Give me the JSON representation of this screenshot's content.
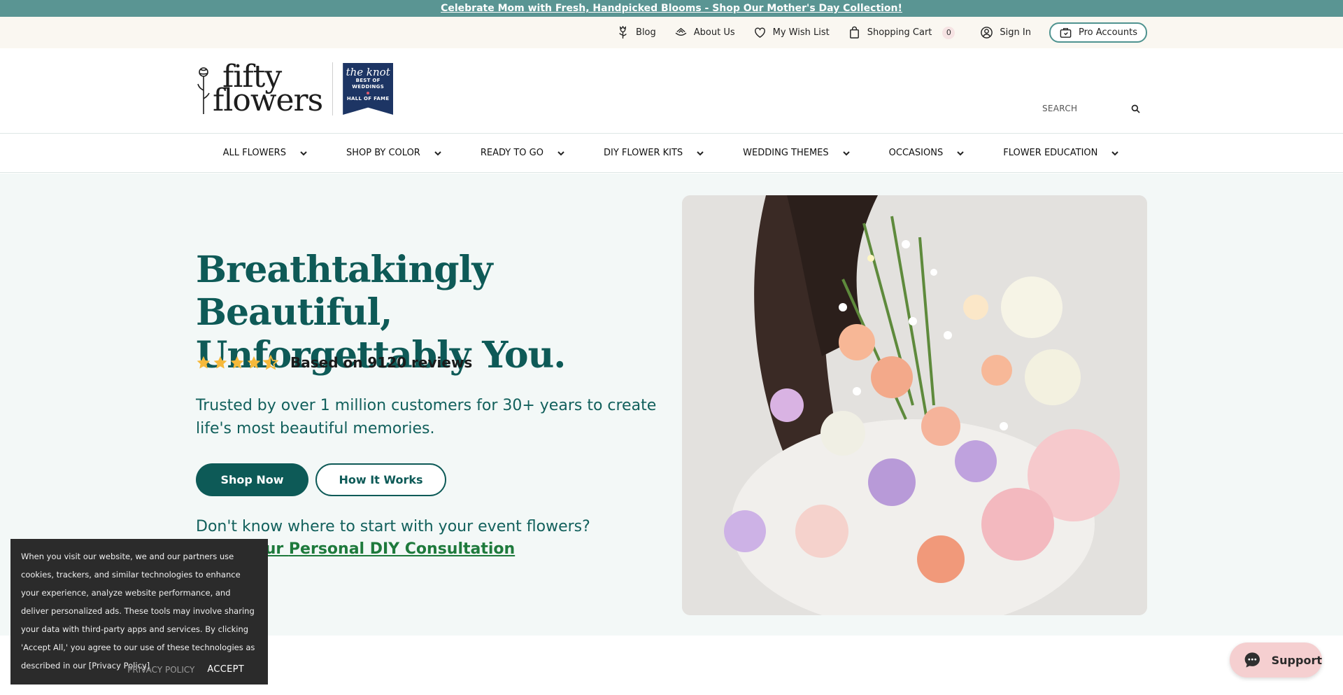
{
  "announcement": {
    "text": "Celebrate Mom with Fresh, Handpicked Blooms - Shop Our Mother's Day Collection!"
  },
  "utility_nav": {
    "blog": "Blog",
    "about": "About Us",
    "wishlist": "My Wish List",
    "cart": "Shopping Cart",
    "cart_count": "0",
    "signin": "Sign In",
    "pro": "Pro Accounts"
  },
  "logo": {
    "line1": "fifty",
    "line2": "flowers"
  },
  "badge": {
    "title": "the knot",
    "line1": "BEST OF",
    "line2": "WEDDINGS",
    "line3": "HALL OF FAME"
  },
  "search": {
    "placeholder": "SEARCH"
  },
  "main_nav": [
    {
      "label": "ALL FLOWERS"
    },
    {
      "label": "SHOP BY COLOR"
    },
    {
      "label": "READY TO GO"
    },
    {
      "label": "DIY FLOWER KITS"
    },
    {
      "label": "WEDDING THEMES"
    },
    {
      "label": "OCCASIONS"
    },
    {
      "label": "FLOWER EDUCATION"
    }
  ],
  "hero": {
    "title_line1": "Breathtakingly Beautiful,",
    "title_line2": "Unforgettably You.",
    "rating_value": 4.5,
    "rating_text": "Based on 9120 reviews",
    "trusted": "Trusted by over 1 million customers for 30+ years to create life's most beautiful memories.",
    "shop_now": "Shop Now",
    "how_it_works": "How It Works",
    "consult_question": "Don't know where to start with your event flowers?",
    "consult_prefix": "Book your ",
    "consult_link": "Personal DIY Consultation"
  },
  "cookie": {
    "text": "When you visit our website, we and our partners use cookies, trackers, and similar technologies to enhance your experience, analyze website performance, and deliver personalized ads. These tools may involve sharing your data with third-party apps and services. By clicking 'Accept All,' you agree to our use of these technologies as described in our [Privacy Policy]",
    "privacy": "PRIVACY POLICY",
    "accept": "ACCEPT"
  },
  "support": {
    "label": "Support"
  },
  "colors": {
    "brand": "#0d5a57",
    "announce_bg": "#5a9593",
    "star": "#f6b93b",
    "support_bg": "#f5cfd0"
  },
  "icons": [
    "tulip-icon",
    "hands-flower-icon",
    "heart-icon",
    "shopping-bag-icon",
    "user-circle-icon",
    "briefcase-icon",
    "search-icon",
    "chevron-down-icon",
    "star-icon",
    "chat-bubble-icon"
  ]
}
